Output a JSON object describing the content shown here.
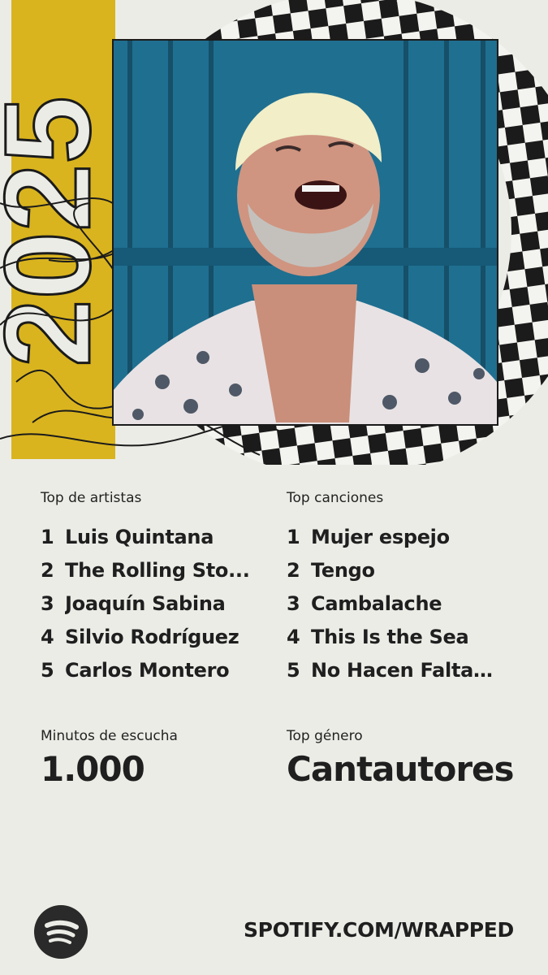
{
  "header": {
    "year": "2025"
  },
  "photo": {
    "icon": "artist-photo-laughing-man"
  },
  "top_artists": {
    "label": "Top de artistas",
    "items": [
      {
        "rank": "1",
        "name": "Luis Quintana"
      },
      {
        "rank": "2",
        "name": "The Rolling Sto..."
      },
      {
        "rank": "3",
        "name": "Joaquín Sabina"
      },
      {
        "rank": "4",
        "name": "Silvio Rodríguez"
      },
      {
        "rank": "5",
        "name": "Carlos Montero"
      }
    ]
  },
  "top_songs": {
    "label": "Top canciones",
    "items": [
      {
        "rank": "1",
        "name": "Mujer espejo"
      },
      {
        "rank": "2",
        "name": "Tengo"
      },
      {
        "rank": "3",
        "name": "Cambalache"
      },
      {
        "rank": "4",
        "name": "This Is the Sea"
      },
      {
        "rank": "5",
        "name": "No Hacen Falta ..."
      }
    ]
  },
  "minutes": {
    "label": "Minutos de escucha",
    "value": "1.000"
  },
  "genre": {
    "label": "Top género",
    "value": "Cantautores"
  },
  "footer": {
    "logo_icon": "spotify-logo-icon",
    "url": "SPOTIFY.COM/WRAPPED"
  },
  "colors": {
    "background": "#ecece7",
    "accent_yellow": "#d9b41e",
    "checker_dark": "#1b1b1b",
    "photo_blue": "#1f6f90"
  }
}
